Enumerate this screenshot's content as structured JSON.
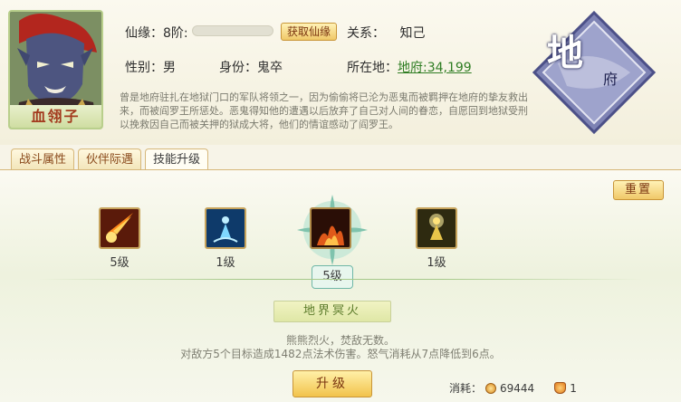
{
  "character": {
    "name": "血翎子",
    "xianyuan_label": "仙缘：",
    "xianyuan_stage": "8阶:",
    "xianyuan_progress": 0.0,
    "get_xianyuan_button": "获取仙缘",
    "relation_label": "关系：",
    "relation_value": "知己",
    "gender_label": "性别：",
    "gender_value": "男",
    "identity_label": "身份：",
    "identity_value": "鬼卒",
    "location_label": "所在地：",
    "location_value": "地府:34,199",
    "description": "曾是地府驻扎在地狱门口的军队将领之一，因为偷偷将已沦为恶鬼而被羁押在地府的挚友救出来，而被阎罗王所惩处。恶鬼得知他的遭遇以后放弃了自己对人间的眷恋，自愿回到地狱受刑以挽救因自己而被关押的狱成大将，他们的情谊感动了阎罗王。"
  },
  "emblem": {
    "big_char": "地",
    "small_char": "府"
  },
  "tabs": [
    {
      "label": "战斗属性",
      "active": false
    },
    {
      "label": "伙伴际遇",
      "active": false
    },
    {
      "label": "技能升级",
      "active": true
    }
  ],
  "reset_button": "重置",
  "skills": [
    {
      "level": "5级",
      "icon": "meteor-icon"
    },
    {
      "level": "1级",
      "icon": "water-figure-icon"
    },
    {
      "level": "5级",
      "icon": "hellfire-icon"
    },
    {
      "level": "1级",
      "icon": "golden-figure-icon"
    }
  ],
  "selected_skill": {
    "name": "地界冥火",
    "level": "5级",
    "flavor": "熊熊烈火，焚敌无数。",
    "effect": "对敌方5个目标造成1482点法术伤害。怒气消耗从7点降低到6点。"
  },
  "upgrade_button": "升级",
  "cost": {
    "label": "消耗：",
    "coin_value": "69444",
    "item_value": "1"
  },
  "colors": {
    "accent_green": "#5b7b2a",
    "link_green": "#2f7d23",
    "button_gold": "#f0c868",
    "tab_border": "#d6b77a"
  }
}
